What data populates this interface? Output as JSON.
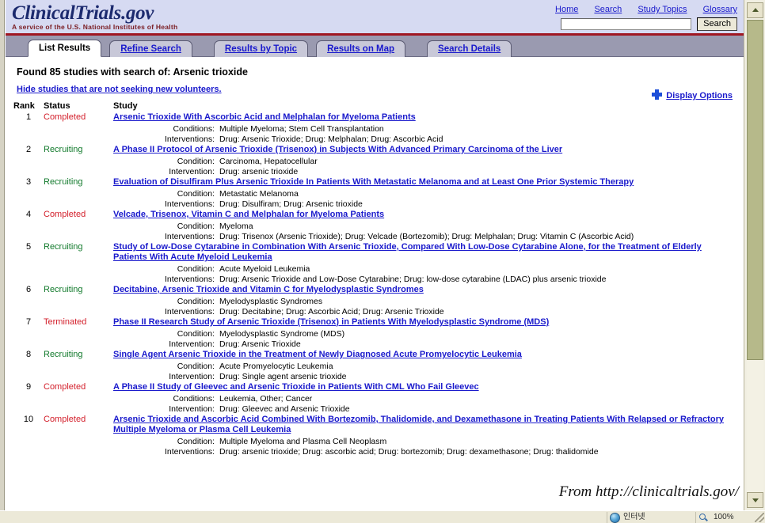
{
  "masthead": {
    "logo_text": "ClinicalTrials.gov",
    "tagline": "A service of the U.S. National Institutes of Health",
    "nav_links": [
      {
        "label": "Home"
      },
      {
        "label": "Search"
      },
      {
        "label": "Study Topics"
      },
      {
        "label": "Glossary"
      }
    ],
    "search": {
      "value": "",
      "placeholder": "",
      "button_label": "Search"
    },
    "accent_rule_color": "#a01722",
    "background_color": "#d6daf2"
  },
  "tabs": [
    {
      "label": "List Results",
      "active": true
    },
    {
      "label": "Refine Search",
      "active": false
    },
    {
      "label": "Results by Topic",
      "active": false
    },
    {
      "label": "Results on Map",
      "active": false
    },
    {
      "label": "Search Details",
      "active": false
    }
  ],
  "results": {
    "heading": "Found 85 studies with search of:  Arsenic trioxide",
    "found_count": "85",
    "search_term": "Arsenic trioxide",
    "hide_studies_link": "Hide studies that are not seeking new volunteers.",
    "display_options_label": "Display Options",
    "display_options_icon": "plus-cross-icon",
    "columns": {
      "rank": "Rank",
      "status": "Status",
      "study": "Study"
    },
    "status_colors": {
      "recruiting": "#127a2c",
      "completed": "#d31f2b",
      "terminated": "#d31f2b"
    },
    "rows": [
      {
        "rank": "1",
        "status": "Completed",
        "status_kind": "completed",
        "title": "Arsenic Trioxide With Ascorbic Acid and Melphalan for Myeloma Patients",
        "meta": [
          {
            "label": "Conditions:",
            "value": "Multiple Myeloma;   Stem Cell Transplantation"
          },
          {
            "label": "Interventions:",
            "value": "Drug: Arsenic Trioxide;   Drug: Melphalan;   Drug: Ascorbic Acid"
          }
        ]
      },
      {
        "rank": "2",
        "status": "Recruiting",
        "status_kind": "recruiting",
        "title": "A Phase II Protocol of Arsenic Trioxide (Trisenox) in Subjects With Advanced Primary Carcinoma of the Liver",
        "meta": [
          {
            "label": "Condition:",
            "value": "Carcinoma, Hepatocellular"
          },
          {
            "label": "Intervention:",
            "value": "Drug: arsenic trioxide"
          }
        ]
      },
      {
        "rank": "3",
        "status": "Recruiting",
        "status_kind": "recruiting",
        "title": "Evaluation of Disulfiram Plus Arsenic Trioxide In Patients With Metastatic Melanoma and at Least One Prior Systemic Therapy",
        "meta": [
          {
            "label": "Condition:",
            "value": "Metastatic Melanoma"
          },
          {
            "label": "Interventions:",
            "value": "Drug: Disulfiram;   Drug: Arsenic trioxide"
          }
        ]
      },
      {
        "rank": "4",
        "status": "Completed",
        "status_kind": "completed",
        "title": "Velcade, Trisenox, Vitamin C and Melphalan for Myeloma Patients",
        "meta": [
          {
            "label": "Condition:",
            "value": "Myeloma"
          },
          {
            "label": "Interventions:",
            "value": "Drug: Trisenox (Arsenic Trioxide);   Drug: Velcade (Bortezomib);   Drug: Melphalan;   Drug: Vitamin C (Ascorbic Acid)"
          }
        ]
      },
      {
        "rank": "5",
        "status": "Recruiting",
        "status_kind": "recruiting",
        "title": "Study of Low-Dose Cytarabine in Combination With Arsenic Trioxide, Compared With Low-Dose Cytarabine Alone, for the Treatment of Elderly Patients With Acute Myeloid Leukemia",
        "meta": [
          {
            "label": "Condition:",
            "value": "Acute Myeloid Leukemia"
          },
          {
            "label": "Interventions:",
            "value": "Drug: Arsenic Trioxide and Low-Dose Cytarabine;   Drug: low-dose cytarabine (LDAC) plus arsenic trioxide"
          }
        ]
      },
      {
        "rank": "6",
        "status": "Recruiting",
        "status_kind": "recruiting",
        "title": "Decitabine, Arsenic Trioxide and Vitamin C for Myelodysplastic Syndromes",
        "meta": [
          {
            "label": "Condition:",
            "value": "Myelodysplastic Syndromes"
          },
          {
            "label": "Interventions:",
            "value": "Drug: Decitabine;   Drug: Ascorbic Acid;   Drug: Arsenic Trioxide"
          }
        ]
      },
      {
        "rank": "7",
        "status": "Terminated",
        "status_kind": "terminated",
        "title": "Phase II Research Study of Arsenic Trioxide (Trisenox) in Patients With Myelodysplastic Syndrome (MDS)",
        "meta": [
          {
            "label": "Condition:",
            "value": "Myelodysplastic Syndrome (MDS)"
          },
          {
            "label": "Intervention:",
            "value": "Drug: Arsenic Trioxide"
          }
        ]
      },
      {
        "rank": "8",
        "status": "Recruiting",
        "status_kind": "recruiting",
        "title": "Single Agent Arsenic Trioxide in the Treatment of Newly Diagnosed Acute Promyelocytic Leukemia",
        "meta": [
          {
            "label": "Condition:",
            "value": "Acute Promyelocytic Leukemia"
          },
          {
            "label": "Intervention:",
            "value": "Drug: Single agent arsenic trioxide"
          }
        ]
      },
      {
        "rank": "9",
        "status": "Completed",
        "status_kind": "completed",
        "title": "A Phase II Study of Gleevec and Arsenic Trioxide in Patients With CML Who Fail Gleevec",
        "meta": [
          {
            "label": "Conditions:",
            "value": "Leukemia, Other;   Cancer"
          },
          {
            "label": "Intervention:",
            "value": "Drug: Gleevec and Arsenic Trioxide"
          }
        ]
      },
      {
        "rank": "10",
        "status": "Completed",
        "status_kind": "completed",
        "title": "Arsenic Trioxide and Ascorbic Acid Combined With Bortezomib, Thalidomide, and Dexamethasone in Treating Patients With Relapsed or Refractory Multiple Myeloma or Plasma Cell Leukemia",
        "meta": [
          {
            "label": "Condition:",
            "value": "Multiple Myeloma and Plasma Cell Neoplasm"
          },
          {
            "label": "Interventions:",
            "value": "Drug: arsenic trioxide;   Drug: ascorbic acid;   Drug: bortezomib;   Drug: dexamethasone;   Drug: thalidomide"
          }
        ]
      }
    ]
  },
  "watermark": {
    "text": "From http://clinicaltrials.gov/"
  },
  "status_bar": {
    "left_text": "",
    "zone_text": "인터넷",
    "zone_icon": "internet-globe-icon",
    "zoom_text": "100%",
    "zoom_icon": "magnifier-icon"
  },
  "scrollbar": {
    "up_icon": "chevron-up-icon",
    "down_icon": "chevron-down-icon"
  }
}
